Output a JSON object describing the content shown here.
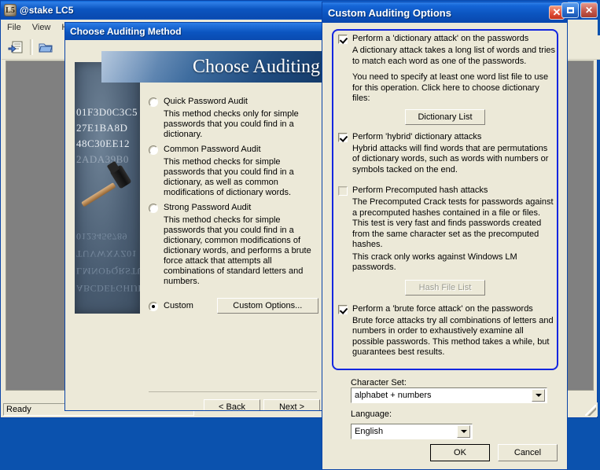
{
  "main_window": {
    "title": "@stake LC5",
    "icon": "lc5-logo-icon",
    "menus": [
      "File",
      "View",
      "Help"
    ],
    "toolbar": [
      {
        "name": "new-session-icon",
        "label": ""
      },
      {
        "name": "open-session-icon",
        "label": ""
      }
    ],
    "status": "Ready",
    "window_buttons": {
      "maximize": "maximize-icon",
      "close": "close-icon"
    }
  },
  "wizard": {
    "title": "Choose Auditing Method",
    "banner_text": "Choose Auditing",
    "art": {
      "hex_lines": [
        "01F3D0C3C5",
        "27E1BA8D",
        "48C30EE12",
        "2ADA39B0"
      ],
      "reverse_lines": [
        "0123456789",
        "TUVWXYZ01",
        "LMNOPQRSTU",
        "ABCDEFGHIJK"
      ]
    },
    "options": [
      {
        "label": "Quick Password Audit",
        "checked": false,
        "desc": "This method checks only for simple passwords that you could find in a dictionary."
      },
      {
        "label": "Common Password Audit",
        "checked": false,
        "desc": "This method checks for simple passwords that you could find in a dictionary, as well as common modifications of dictionary words."
      },
      {
        "label": "Strong Password Audit",
        "checked": false,
        "desc": "This method checks for simple passwords that you could find in a dictionary, common modifications of dictionary words, and performs a brute force attack that attempts all combinations of standard letters and numbers."
      },
      {
        "label": "Custom",
        "checked": true,
        "desc": "",
        "button": "Custom Options..."
      }
    ],
    "nav": {
      "back": "< Back",
      "next": "Next >"
    }
  },
  "dialog": {
    "title": "Custom Auditing Options",
    "close_icon": "close-icon",
    "items": [
      {
        "label": "Perform a 'dictionary attack' on the passwords",
        "checked": true,
        "enabled": true,
        "paragraphs": [
          "A dictionary attack takes a long list of words and tries to match each word as one of the passwords.",
          "You need to specify at least one word list file to use for this operation. Click here to choose dictionary files:"
        ],
        "button": {
          "label": "Dictionary List",
          "enabled": true
        }
      },
      {
        "label": "Perform 'hybrid' dictionary attacks",
        "checked": true,
        "enabled": true,
        "paragraphs": [
          "Hybrid attacks will find words that are permutations of dictionary words, such as words with numbers or symbols tacked on the end."
        ],
        "button": null
      },
      {
        "label": "Perform Precomputed hash attacks",
        "checked": false,
        "enabled": false,
        "paragraphs": [
          "The Precomputed Crack tests for passwords against a precomputed hashes contained in a file or files. This test is very fast and finds passwords created from the same character set as the precomputed hashes.",
          "This crack only works against Windows LM passwords."
        ],
        "button": {
          "label": "Hash File List",
          "enabled": false
        }
      },
      {
        "label": "Perform a 'brute force attack' on the passwords",
        "checked": true,
        "enabled": true,
        "paragraphs": [
          "Brute force attacks try all combinations of letters and numbers in order to exhaustively examine all possible passwords. This method takes a while, but guarantees best results."
        ],
        "button": null
      }
    ],
    "character_set": {
      "label": "Character Set:",
      "value": "alphabet + numbers"
    },
    "language": {
      "label": "Language:",
      "value": "English"
    },
    "ok": "OK",
    "cancel": "Cancel"
  },
  "colors": {
    "title_blue": "#0B55C0",
    "face": "#ECE9D8",
    "group_border": "#1326E0",
    "desktop": "#0B52AE",
    "client": "#808080"
  }
}
